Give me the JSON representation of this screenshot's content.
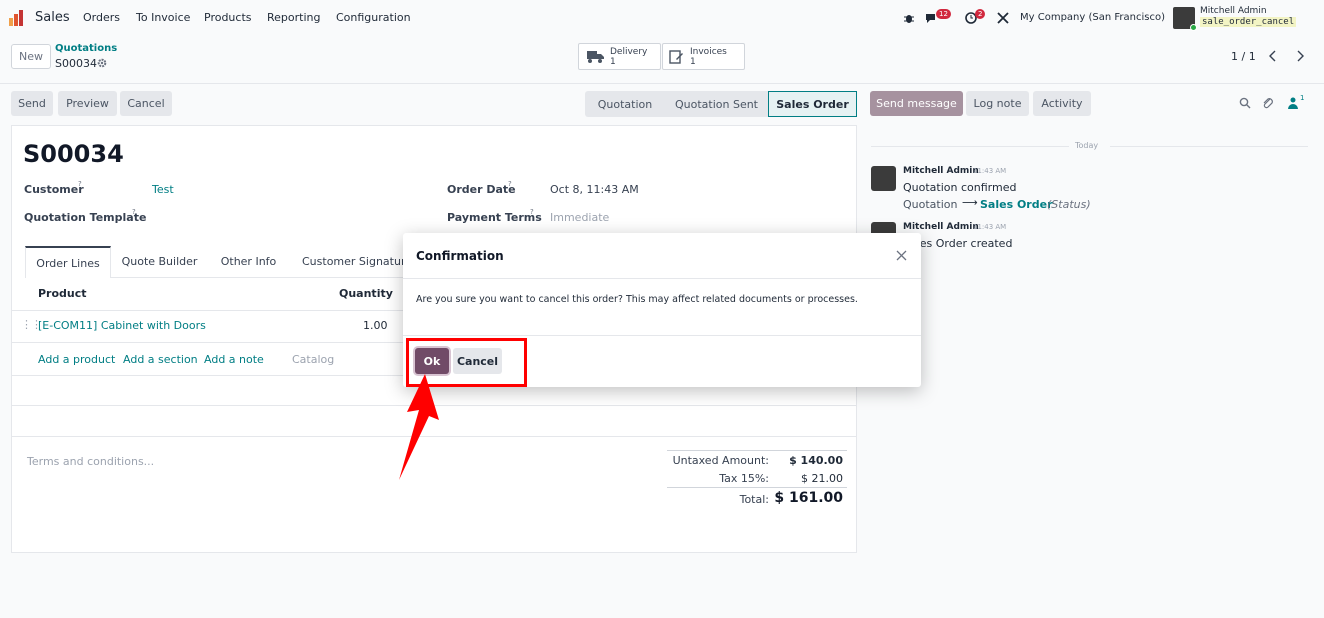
{
  "navbar": {
    "app": "Sales",
    "menu": [
      "Orders",
      "To Invoice",
      "Products",
      "Reporting",
      "Configuration"
    ],
    "messages_badge": "12",
    "activities_badge": "2",
    "company": "My Company (San Francisco)",
    "user_name": "Mitchell Admin",
    "user_db": "sale_order_cancel"
  },
  "control": {
    "new_label": "New",
    "breadcrumb_parent": "Quotations",
    "breadcrumb_current": "S00034",
    "delivery_label": "Delivery",
    "delivery_count": "1",
    "invoices_label": "Invoices",
    "invoices_count": "1",
    "pager": "1 / 1"
  },
  "actions": {
    "send": "Send",
    "preview": "Preview",
    "cancel": "Cancel"
  },
  "statusbar": {
    "stages": [
      "Quotation",
      "Quotation Sent",
      "Sales Order"
    ],
    "active": "Sales Order"
  },
  "form": {
    "name": "S00034",
    "customer_label": "Customer",
    "customer_value": "Test",
    "template_label": "Quotation Template",
    "order_date_label": "Order Date",
    "order_date_value": "Oct 8, 11:43 AM",
    "payment_terms_label": "Payment Terms",
    "payment_terms_placeholder": "Immediate",
    "tabs": [
      "Order Lines",
      "Quote Builder",
      "Other Info",
      "Customer Signature"
    ],
    "col_product": "Product",
    "col_quantity": "Quantity",
    "line_product": "[E-COM11] Cabinet with Doors",
    "line_quantity": "1.00",
    "add_product": "Add a product",
    "add_section": "Add a section",
    "add_note": "Add a note",
    "catalog": "Catalog",
    "terms_placeholder": "Terms and conditions...",
    "untaxed_label": "Untaxed Amount:",
    "untaxed_value": "$ 140.00",
    "tax_label": "Tax 15%:",
    "tax_value": "$ 21.00",
    "total_label": "Total:",
    "total_value": "$ 161.00"
  },
  "chatter": {
    "send_message": "Send message",
    "log_note": "Log note",
    "activity": "Activity",
    "followers_count": "1",
    "date_separator": "Today",
    "msg1_author": "Mitchell Admin",
    "msg1_time": "11:43 AM",
    "msg1_body": "Quotation confirmed",
    "msg1_from": "Quotation",
    "msg1_to": "Sales Order",
    "msg1_field": "(Status)",
    "msg2_author": "Mitchell Admin",
    "msg2_time": "11:43 AM",
    "msg2_body": "Sales Order created"
  },
  "dialog": {
    "title": "Confirmation",
    "body": "Are you sure you want to cancel this order? This may affect related documents or processes.",
    "ok": "Ok",
    "cancel": "Cancel"
  },
  "colors": {
    "primary": "#714b67",
    "link": "#017e84",
    "highlight": "#ff0000"
  }
}
